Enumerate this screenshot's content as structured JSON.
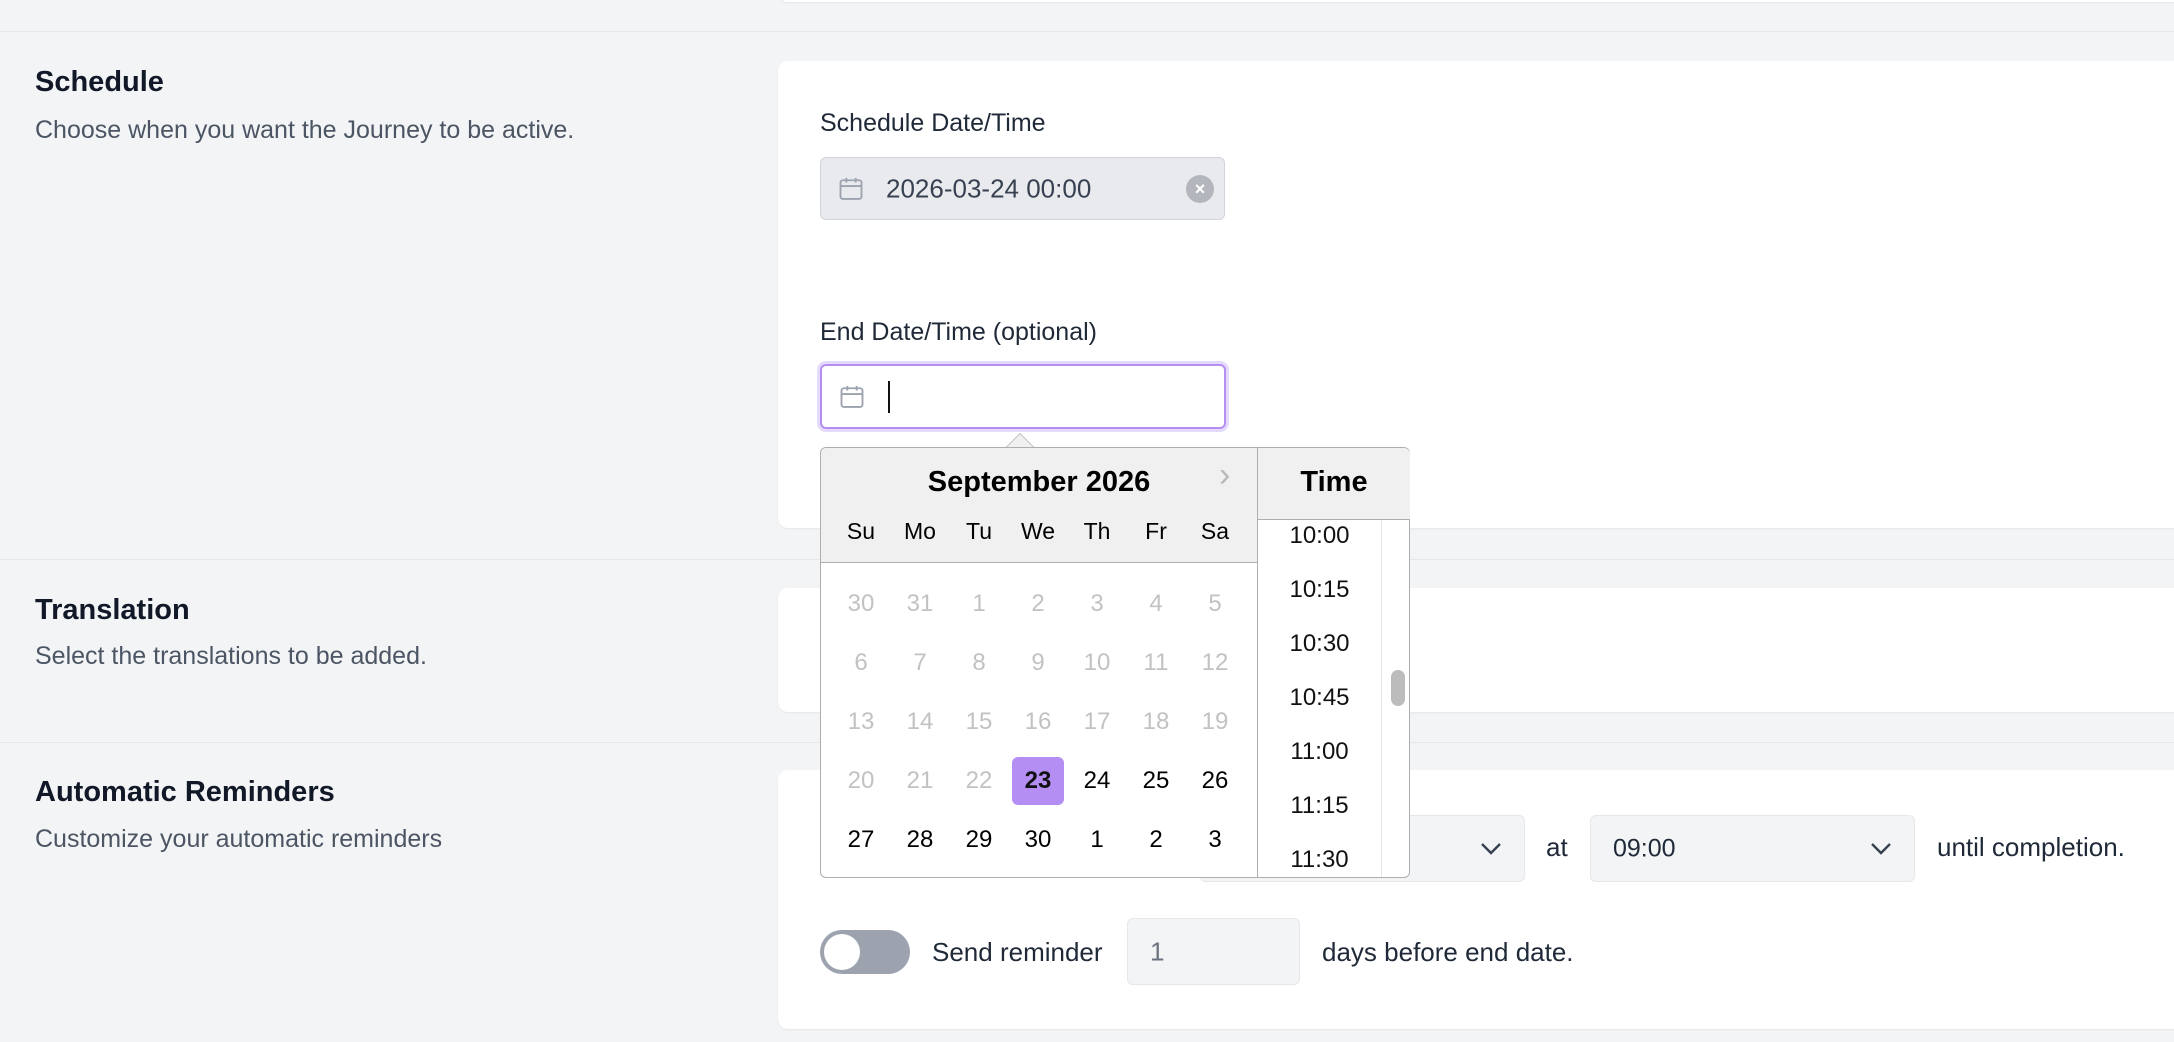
{
  "schedule": {
    "title": "Schedule",
    "description": "Choose when you want the Journey to be active.",
    "schedule_label": "Schedule Date/Time",
    "schedule_value": "2026-03-24 00:00",
    "end_label": "End Date/Time (optional)",
    "end_value": ""
  },
  "datepicker": {
    "month_label": "September 2026",
    "weekdays": [
      "Su",
      "Mo",
      "Tu",
      "We",
      "Th",
      "Fr",
      "Sa"
    ],
    "weeks": [
      [
        {
          "d": "30",
          "s": "out"
        },
        {
          "d": "31",
          "s": "out"
        },
        {
          "d": "1",
          "s": "out"
        },
        {
          "d": "2",
          "s": "out"
        },
        {
          "d": "3",
          "s": "out"
        },
        {
          "d": "4",
          "s": "out"
        },
        {
          "d": "5",
          "s": "out"
        }
      ],
      [
        {
          "d": "6",
          "s": "out"
        },
        {
          "d": "7",
          "s": "out"
        },
        {
          "d": "8",
          "s": "out"
        },
        {
          "d": "9",
          "s": "out"
        },
        {
          "d": "10",
          "s": "out"
        },
        {
          "d": "11",
          "s": "out"
        },
        {
          "d": "12",
          "s": "out"
        }
      ],
      [
        {
          "d": "13",
          "s": "out"
        },
        {
          "d": "14",
          "s": "out"
        },
        {
          "d": "15",
          "s": "out"
        },
        {
          "d": "16",
          "s": "out"
        },
        {
          "d": "17",
          "s": "out"
        },
        {
          "d": "18",
          "s": "out"
        },
        {
          "d": "19",
          "s": "out"
        }
      ],
      [
        {
          "d": "20",
          "s": "out"
        },
        {
          "d": "21",
          "s": "out"
        },
        {
          "d": "22",
          "s": "out"
        },
        {
          "d": "23",
          "s": "sel"
        },
        {
          "d": "24",
          "s": "in"
        },
        {
          "d": "25",
          "s": "in"
        },
        {
          "d": "26",
          "s": "in"
        }
      ],
      [
        {
          "d": "27",
          "s": "in"
        },
        {
          "d": "28",
          "s": "in"
        },
        {
          "d": "29",
          "s": "in"
        },
        {
          "d": "30",
          "s": "in"
        },
        {
          "d": "1",
          "s": "in"
        },
        {
          "d": "2",
          "s": "in"
        },
        {
          "d": "3",
          "s": "in"
        }
      ]
    ],
    "time_title": "Time",
    "times": [
      "10:00",
      "10:15",
      "10:30",
      "10:45",
      "11:00",
      "11:15",
      "11:30"
    ],
    "accent_color": "#b48ef2"
  },
  "translation": {
    "title": "Translation",
    "description": "Select the translations to be added."
  },
  "reminders": {
    "title": "Automatic Reminders",
    "description": "Customize your automatic reminders",
    "at_label": "at",
    "time_value": "09:00",
    "until_label": "until completion.",
    "send_label": "Send reminder",
    "days_value": "1",
    "days_label": "days before end date.",
    "toggle_on": false
  }
}
